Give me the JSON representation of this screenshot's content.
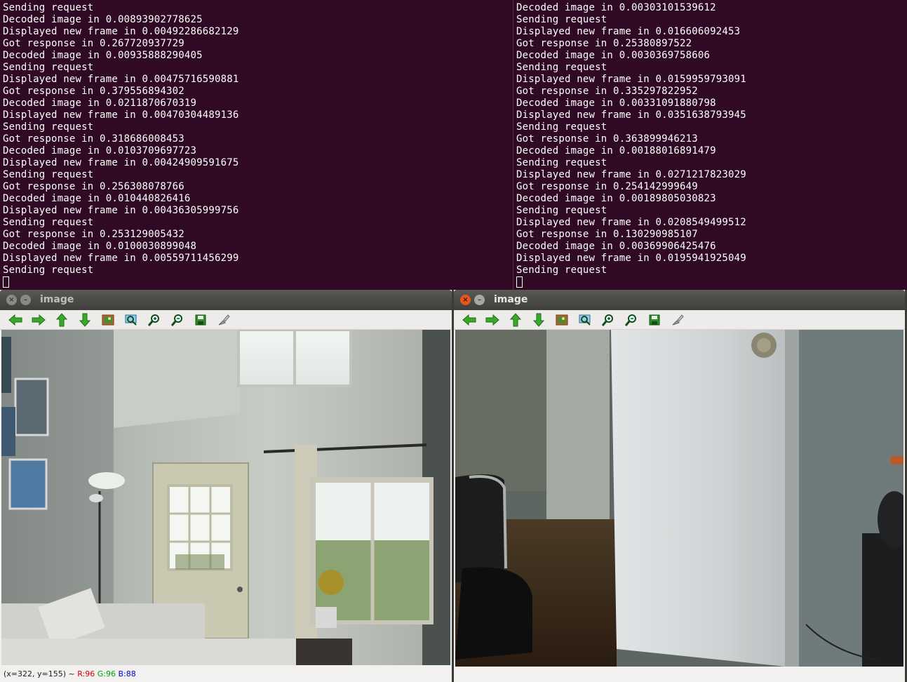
{
  "terminals": {
    "left": [
      "Sending request",
      "Decoded image in 0.00893902778625",
      "Displayed new frame in 0.00492286682129",
      "Got response in 0.267720937729",
      "Decoded image in 0.00935888290405",
      "Sending request",
      "Displayed new frame in 0.00475716590881",
      "Got response in 0.379556894302",
      "Decoded image in 0.0211870670319",
      "Displayed new frame in 0.00470304489136",
      "Sending request",
      "Got response in 0.318686008453",
      "Decoded image in 0.0103709697723",
      "Displayed new frame in 0.00424909591675",
      "Sending request",
      "Got response in 0.256308078766",
      "Decoded image in 0.010440826416",
      "Displayed new frame in 0.00436305999756",
      "Sending request",
      "Got response in 0.253129005432",
      "Decoded image in 0.0100030899048",
      "Displayed new frame in 0.00559711456299",
      "Sending request"
    ],
    "right": [
      "Decoded image in 0.00303101539612",
      "Sending request",
      "Displayed new frame in 0.016606092453",
      "Got response in 0.25380897522",
      "Decoded image in 0.0030369758606",
      "Sending request",
      "Displayed new frame in 0.0159959793091",
      "Got response in 0.335297822952",
      "Decoded image in 0.00331091880798",
      "Displayed new frame in 0.0351638793945",
      "Sending request",
      "Got response in 0.363899946213",
      "Decoded image in 0.00188016891479",
      "Sending request",
      "Displayed new frame in 0.0271217823029",
      "Got response in 0.254142999649",
      "Decoded image in 0.00189805030823",
      "Sending request",
      "Displayed new frame in 0.0208549499512",
      "Got response in 0.130290985107",
      "Decoded image in 0.00369906425476",
      "Displayed new frame in 0.0195941925049",
      "Sending request"
    ]
  },
  "windows": {
    "left": {
      "title": "image",
      "status": {
        "coords": "(x=322, y=155) ~ ",
        "r": "R:96",
        "g": "G:96",
        "b": "B:88"
      }
    },
    "right": {
      "title": "image"
    }
  },
  "toolbar_icons": [
    "arrow-left-icon",
    "arrow-right-icon",
    "arrow-up-icon",
    "arrow-down-icon",
    "zoom-fit-icon",
    "zoom-region-icon",
    "zoom-in-icon",
    "zoom-out-icon",
    "save-icon",
    "properties-icon"
  ],
  "colors": {
    "terminal_bg": "#300a24",
    "terminal_fg": "#ffffff",
    "icon_green": "#3aa82a"
  }
}
